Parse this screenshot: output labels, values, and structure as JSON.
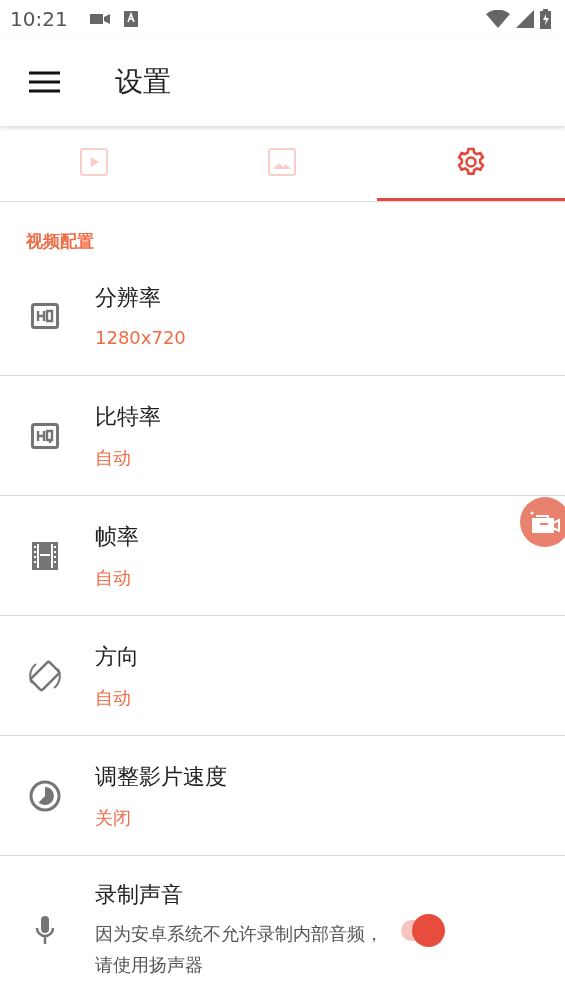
{
  "status_bar": {
    "time": "10:21"
  },
  "app_bar": {
    "title": "设置"
  },
  "tabs": [
    {
      "selected": false
    },
    {
      "selected": false
    },
    {
      "selected": true
    }
  ],
  "section": {
    "title": "视频配置"
  },
  "items": [
    {
      "kind": "value",
      "title": "分辨率",
      "value": "1280x720"
    },
    {
      "kind": "value",
      "title": "比特率",
      "value": "自动"
    },
    {
      "kind": "value",
      "title": "帧率",
      "value": "自动"
    },
    {
      "kind": "value",
      "title": "方向",
      "value": "自动"
    },
    {
      "kind": "value",
      "title": "调整影片速度",
      "value": "关闭"
    },
    {
      "kind": "switch",
      "title": "录制声音",
      "description": "因为安卓系统不允许录制内部音频，请使用扬声器",
      "on": true
    }
  ]
}
